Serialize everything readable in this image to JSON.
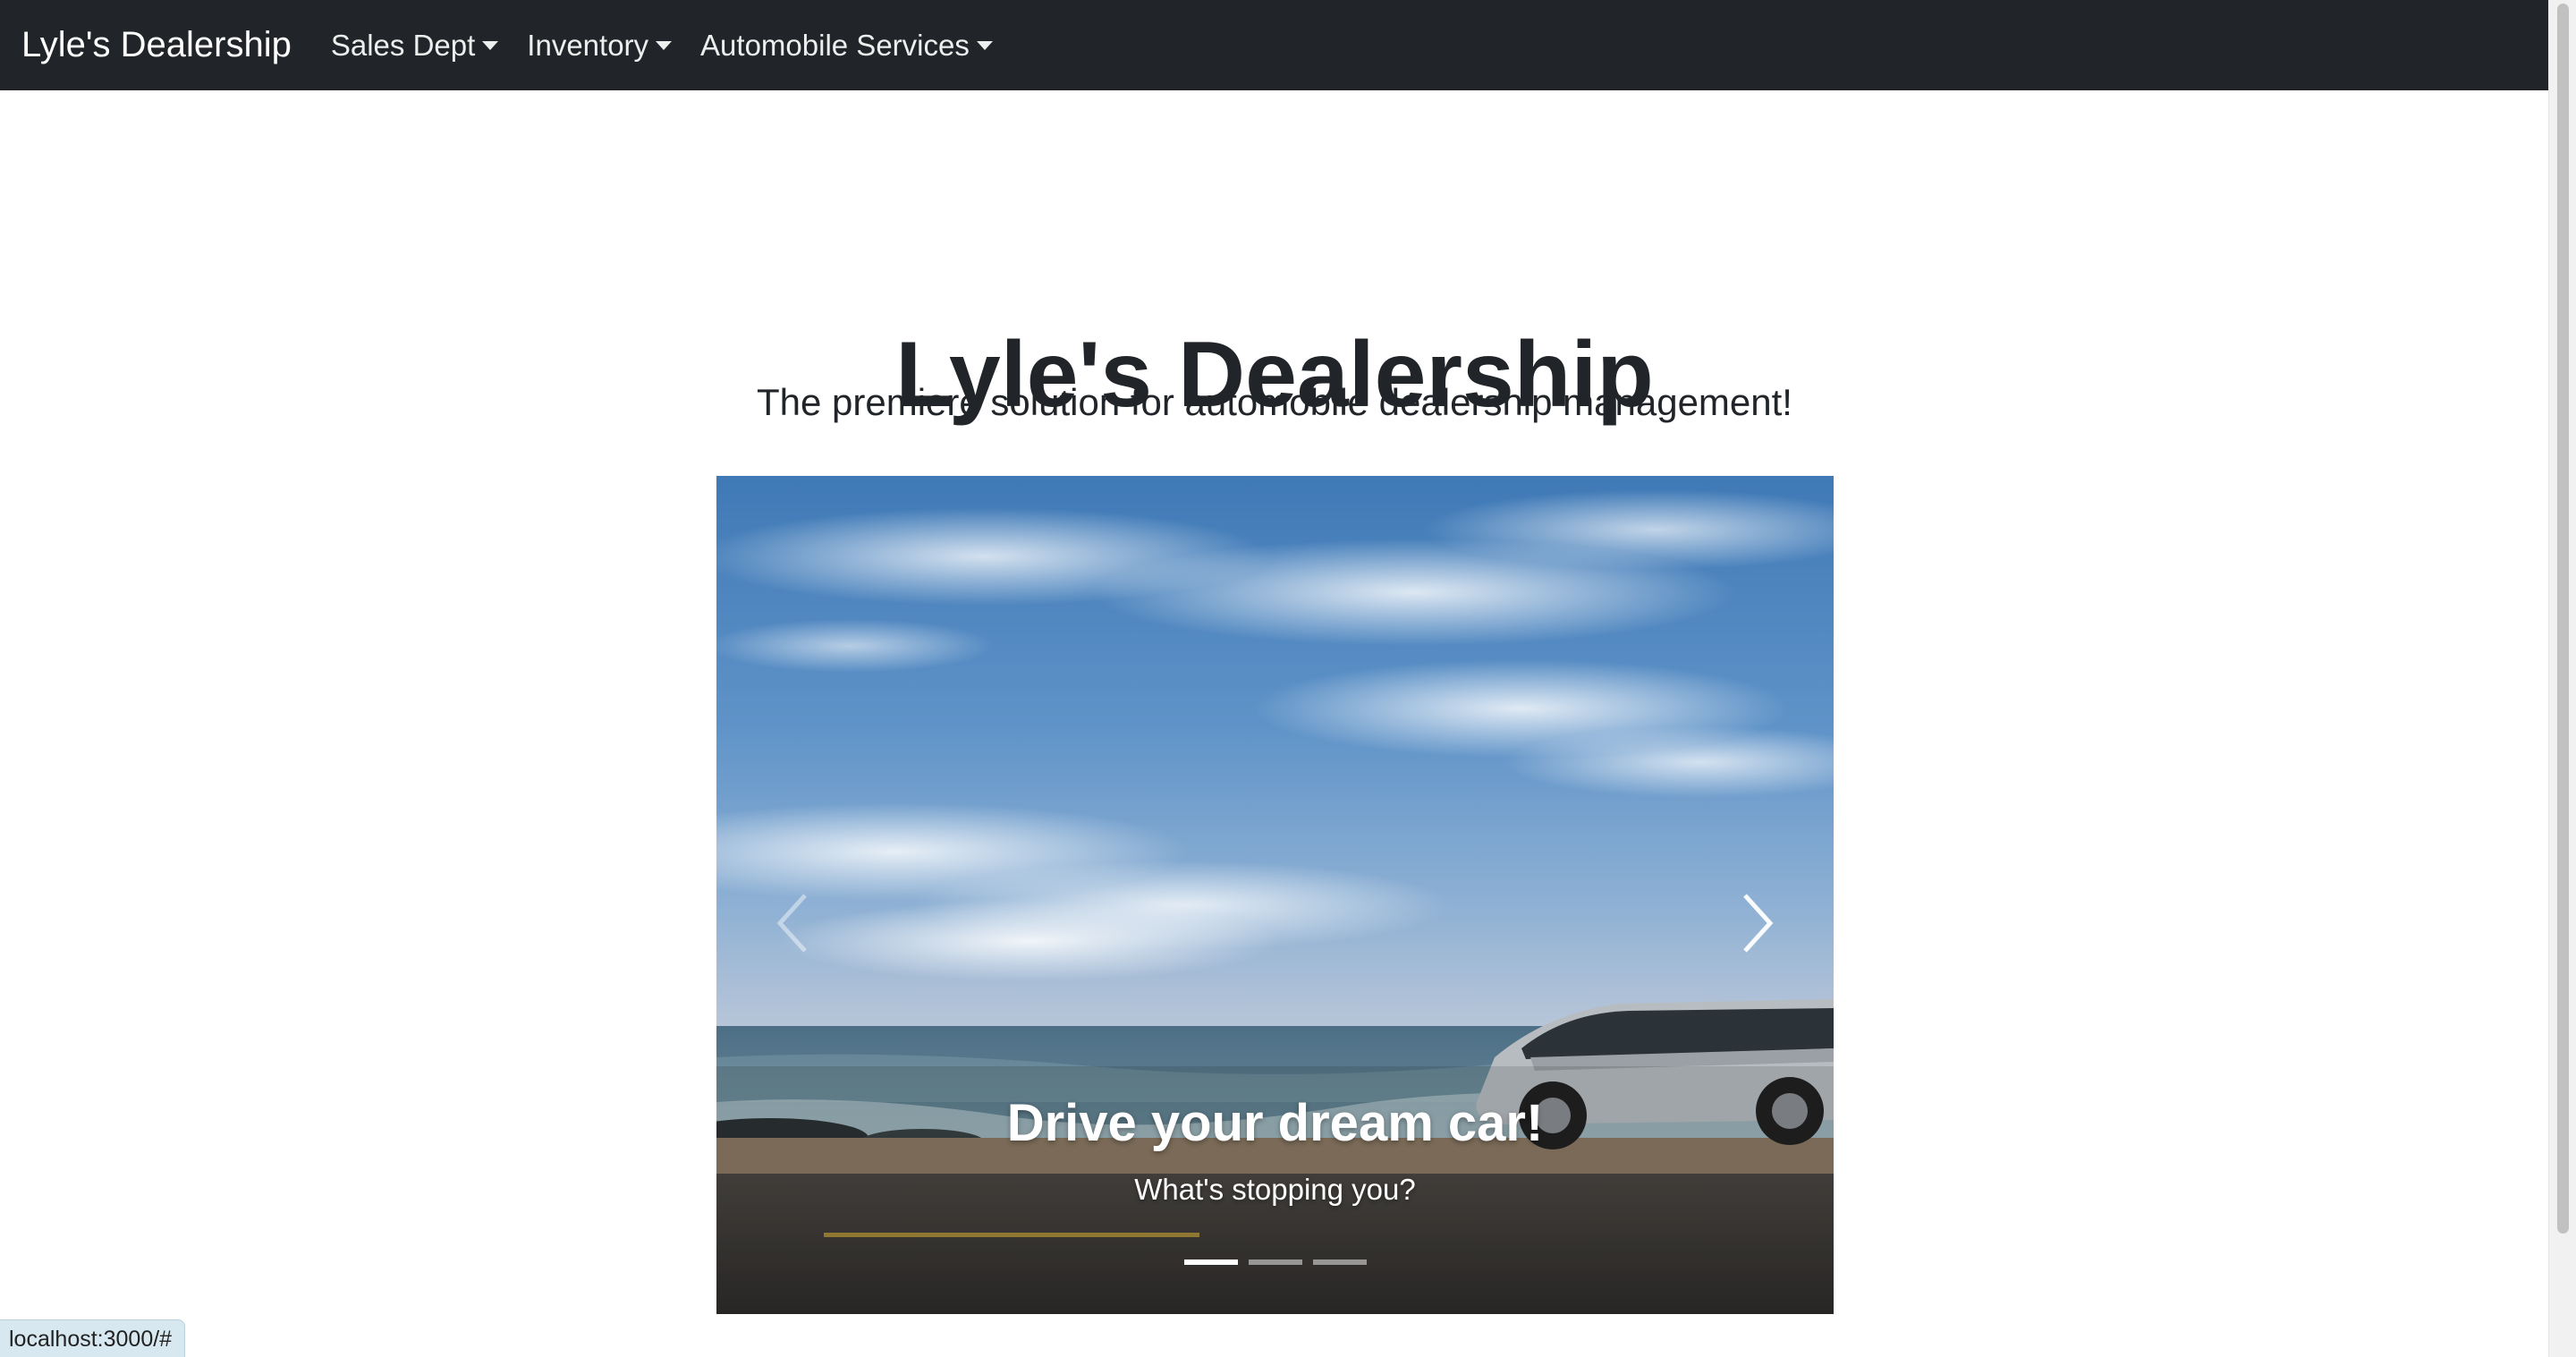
{
  "navbar": {
    "brand": "Lyle's Dealership",
    "items": [
      {
        "label": "Sales Dept"
      },
      {
        "label": "Inventory"
      },
      {
        "label": "Automobile Services"
      }
    ]
  },
  "hero": {
    "title": "Lyle's Dealership",
    "subtitle": "The premiere solution for automobile dealership management!"
  },
  "carousel": {
    "caption_title": "Drive your dream car!",
    "caption_text": "What's stopping you?",
    "slide_count": 3,
    "active_index": 0
  },
  "status_bar": {
    "url": "localhost:3000/#"
  },
  "colors": {
    "navbar_bg": "#212529",
    "text_dark": "#212529"
  }
}
